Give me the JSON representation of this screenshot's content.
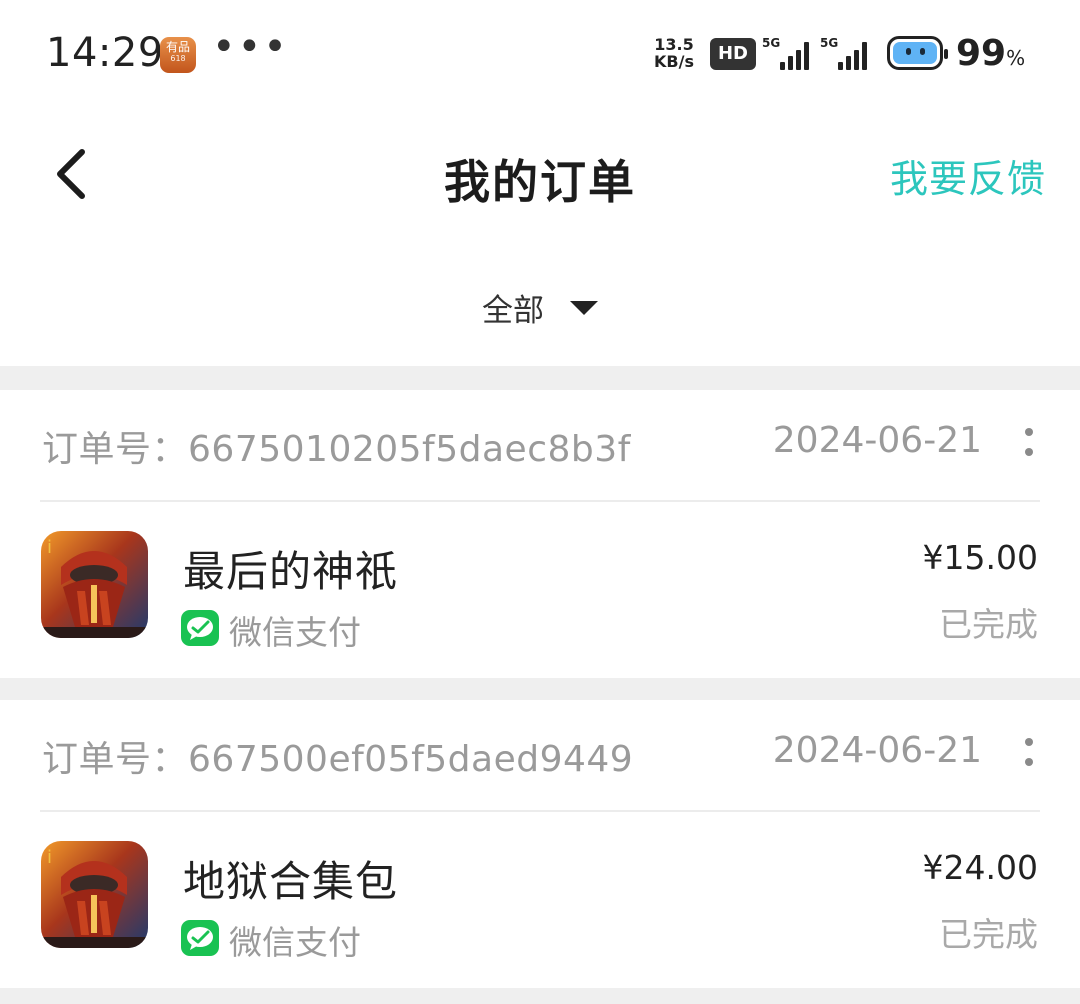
{
  "status_bar": {
    "time": "14:29",
    "app_badge_label": "有品",
    "app_badge_sub": "618",
    "more": "•••",
    "net_speed_value": "13.5",
    "net_speed_unit": "KB/s",
    "hd_label": "HD",
    "signal1_label": "5G",
    "signal2_label": "5G",
    "battery_percent": "99",
    "percent_sign": "%",
    "battery_color": "#5fb3f5"
  },
  "header": {
    "back_icon": "chevron-left-icon",
    "title": "我的订单",
    "feedback_label": "我要反馈",
    "accent_color": "#2cc6bd"
  },
  "filter": {
    "selected": "全部"
  },
  "orders": [
    {
      "order_no_label": "订单号：",
      "order_no": "6675010205f5daec8b3f",
      "date": "2024-06-21",
      "item_title": "最后的神祇",
      "payment_method": "微信支付",
      "price": "¥15.00",
      "status": "已完成"
    },
    {
      "order_no_label": "订单号：",
      "order_no": "667500ef05f5daed9449",
      "date": "2024-06-21",
      "item_title": "地狱合集包",
      "payment_method": "微信支付",
      "price": "¥24.00",
      "status": "已完成"
    }
  ]
}
